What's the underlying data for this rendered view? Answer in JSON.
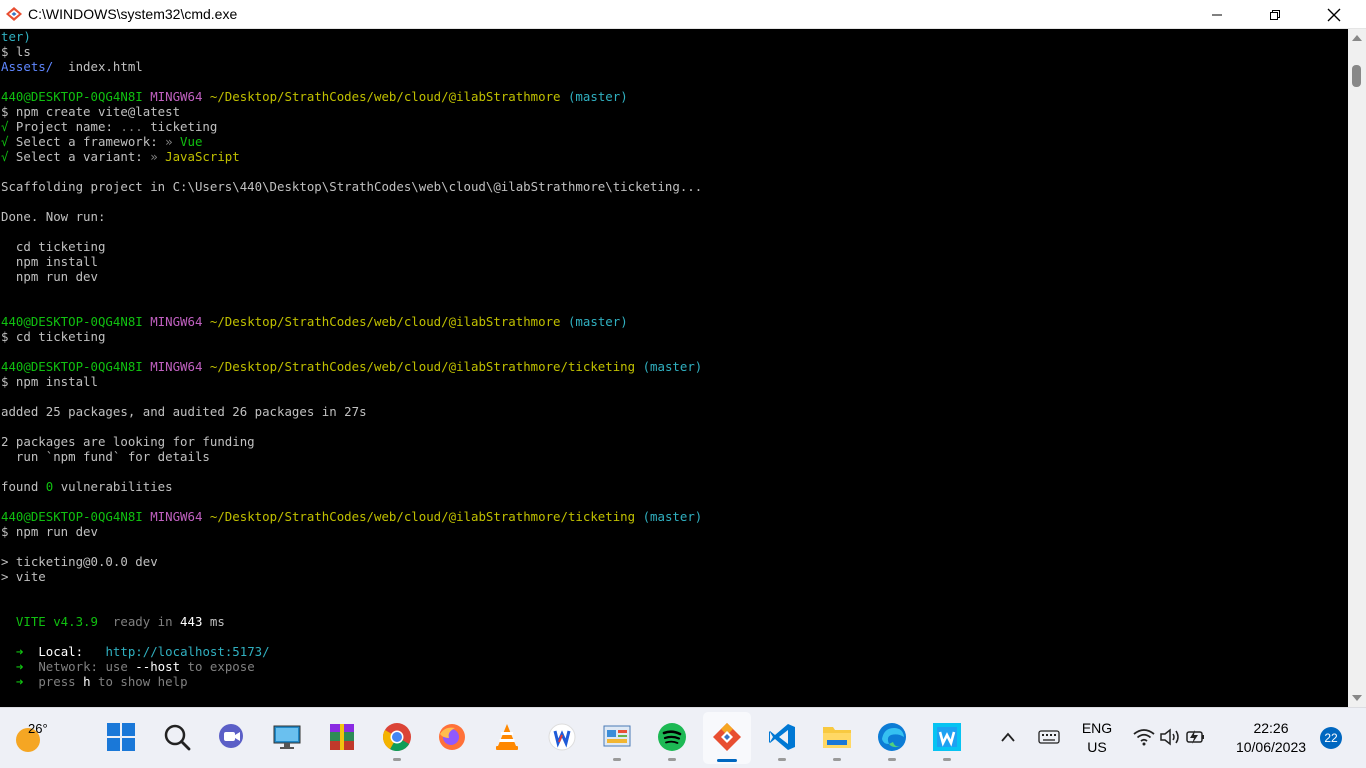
{
  "window": {
    "title": "C:\\WINDOWS\\system32\\cmd.exe",
    "icon": "git-bash-icon",
    "controls": [
      "minimize",
      "restore",
      "close"
    ]
  },
  "terminal": {
    "lines": [
      [
        {
          "t": "ter)",
          "c": "c-cyan"
        }
      ],
      [
        {
          "t": "$ ls",
          "c": ""
        }
      ],
      [
        {
          "t": "Assets/",
          "c": "c-blue"
        },
        {
          "t": "  index.html",
          "c": ""
        }
      ],
      [
        {
          "t": "",
          "c": ""
        }
      ],
      [
        {
          "t": "440@DESKTOP-0QG4N8I ",
          "c": "c-green"
        },
        {
          "t": "MINGW64 ",
          "c": "c-magenta"
        },
        {
          "t": "~/Desktop/StrathCodes/web/cloud/@ilabStrathmore",
          "c": "c-yellow"
        },
        {
          "t": " (master)",
          "c": "c-cyan"
        }
      ],
      [
        {
          "t": "$ npm create vite@latest",
          "c": ""
        }
      ],
      [
        {
          "t": "√ ",
          "c": "c-green"
        },
        {
          "t": "Project name: ",
          "c": ""
        },
        {
          "t": "... ",
          "c": "c-dim"
        },
        {
          "t": "ticketing",
          "c": ""
        }
      ],
      [
        {
          "t": "√ ",
          "c": "c-green"
        },
        {
          "t": "Select a framework: ",
          "c": ""
        },
        {
          "t": "» ",
          "c": "c-dim"
        },
        {
          "t": "Vue",
          "c": "c-green"
        }
      ],
      [
        {
          "t": "√ ",
          "c": "c-green"
        },
        {
          "t": "Select a variant: ",
          "c": ""
        },
        {
          "t": "» ",
          "c": "c-dim"
        },
        {
          "t": "JavaScript",
          "c": "c-yellow"
        }
      ],
      [
        {
          "t": "",
          "c": ""
        }
      ],
      [
        {
          "t": "Scaffolding project in C:\\Users\\440\\Desktop\\StrathCodes\\web\\cloud\\@ilabStrathmore\\ticketing...",
          "c": ""
        }
      ],
      [
        {
          "t": "",
          "c": ""
        }
      ],
      [
        {
          "t": "Done. Now run:",
          "c": ""
        }
      ],
      [
        {
          "t": "",
          "c": ""
        }
      ],
      [
        {
          "t": "  cd ticketing",
          "c": ""
        }
      ],
      [
        {
          "t": "  npm install",
          "c": ""
        }
      ],
      [
        {
          "t": "  npm run dev",
          "c": ""
        }
      ],
      [
        {
          "t": "",
          "c": ""
        }
      ],
      [
        {
          "t": "",
          "c": ""
        }
      ],
      [
        {
          "t": "440@DESKTOP-0QG4N8I ",
          "c": "c-green"
        },
        {
          "t": "MINGW64 ",
          "c": "c-magenta"
        },
        {
          "t": "~/Desktop/StrathCodes/web/cloud/@ilabStrathmore",
          "c": "c-yellow"
        },
        {
          "t": " (master)",
          "c": "c-cyan"
        }
      ],
      [
        {
          "t": "$ cd ticketing",
          "c": ""
        }
      ],
      [
        {
          "t": "",
          "c": ""
        }
      ],
      [
        {
          "t": "440@DESKTOP-0QG4N8I ",
          "c": "c-green"
        },
        {
          "t": "MINGW64 ",
          "c": "c-magenta"
        },
        {
          "t": "~/Desktop/StrathCodes/web/cloud/@ilabStrathmore/ticketing",
          "c": "c-yellow"
        },
        {
          "t": " (master)",
          "c": "c-cyan"
        }
      ],
      [
        {
          "t": "$ npm install",
          "c": ""
        }
      ],
      [
        {
          "t": "",
          "c": ""
        }
      ],
      [
        {
          "t": "added 25 packages, and audited 26 packages in 27s",
          "c": ""
        }
      ],
      [
        {
          "t": "",
          "c": ""
        }
      ],
      [
        {
          "t": "2 packages are looking for funding",
          "c": ""
        }
      ],
      [
        {
          "t": "  run `npm fund` for details",
          "c": ""
        }
      ],
      [
        {
          "t": "",
          "c": ""
        }
      ],
      [
        {
          "t": "found ",
          "c": ""
        },
        {
          "t": "0",
          "c": "c-green"
        },
        {
          "t": " vulnerabilities",
          "c": ""
        }
      ],
      [
        {
          "t": "",
          "c": ""
        }
      ],
      [
        {
          "t": "440@DESKTOP-0QG4N8I ",
          "c": "c-green"
        },
        {
          "t": "MINGW64 ",
          "c": "c-magenta"
        },
        {
          "t": "~/Desktop/StrathCodes/web/cloud/@ilabStrathmore/ticketing",
          "c": "c-yellow"
        },
        {
          "t": " (master)",
          "c": "c-cyan"
        }
      ],
      [
        {
          "t": "$ npm run dev",
          "c": ""
        }
      ],
      [
        {
          "t": "",
          "c": ""
        }
      ],
      [
        {
          "t": "> ticketing@0.0.0 dev",
          "c": ""
        }
      ],
      [
        {
          "t": "> vite",
          "c": ""
        }
      ],
      [
        {
          "t": "",
          "c": ""
        }
      ],
      [
        {
          "t": "",
          "c": ""
        }
      ],
      [
        {
          "t": "  VITE v4.3.9",
          "c": "c-green"
        },
        {
          "t": "  ready in ",
          "c": "c-dim"
        },
        {
          "t": "443",
          "c": "c-bright"
        },
        {
          "t": " ms",
          "c": ""
        }
      ],
      [
        {
          "t": "",
          "c": ""
        }
      ],
      [
        {
          "t": "  ➜  ",
          "c": "c-green"
        },
        {
          "t": "Local:",
          "c": "c-bright"
        },
        {
          "t": "   ",
          "c": ""
        },
        {
          "t": "http://localhost:5173/",
          "c": "c-cyan"
        }
      ],
      [
        {
          "t": "  ➜  ",
          "c": "c-green"
        },
        {
          "t": "Network: use ",
          "c": "c-dim"
        },
        {
          "t": "--host",
          "c": "c-bright"
        },
        {
          "t": " to expose",
          "c": "c-dim"
        }
      ],
      [
        {
          "t": "  ➜  ",
          "c": "c-green"
        },
        {
          "t": "press ",
          "c": "c-dim"
        },
        {
          "t": "h",
          "c": "c-bright"
        },
        {
          "t": " to show help",
          "c": "c-dim"
        }
      ]
    ]
  },
  "taskbar": {
    "weather_temp": "26°",
    "apps": [
      {
        "name": "start-button",
        "icon": "windows-logo-icon"
      },
      {
        "name": "search-button",
        "icon": "search-icon"
      },
      {
        "name": "chat-button",
        "icon": "teams-chat-icon"
      },
      {
        "name": "taskbar-app-remote-desktop",
        "icon": "monitor-icon"
      },
      {
        "name": "taskbar-app-winrar",
        "icon": "winrar-icon"
      },
      {
        "name": "taskbar-app-chrome",
        "icon": "chrome-icon"
      },
      {
        "name": "taskbar-app-firefox",
        "icon": "firefox-icon"
      },
      {
        "name": "taskbar-app-vlc",
        "icon": "vlc-icon"
      },
      {
        "name": "taskbar-app-wps",
        "icon": "wps-icon"
      },
      {
        "name": "taskbar-app-control-panel",
        "icon": "control-panel-icon"
      },
      {
        "name": "taskbar-app-spotify",
        "icon": "spotify-icon"
      },
      {
        "name": "taskbar-app-git-bash",
        "icon": "git-icon"
      },
      {
        "name": "taskbar-app-vscode",
        "icon": "vscode-icon"
      },
      {
        "name": "taskbar-app-file-explorer",
        "icon": "folder-icon"
      },
      {
        "name": "taskbar-app-edge",
        "icon": "edge-icon"
      },
      {
        "name": "taskbar-app-webstorm",
        "icon": "webstorm-icon"
      }
    ],
    "tray": {
      "lang_top": "ENG",
      "lang_bottom": "US",
      "time": "22:26",
      "date": "10/06/2023",
      "notifications": "22"
    }
  }
}
